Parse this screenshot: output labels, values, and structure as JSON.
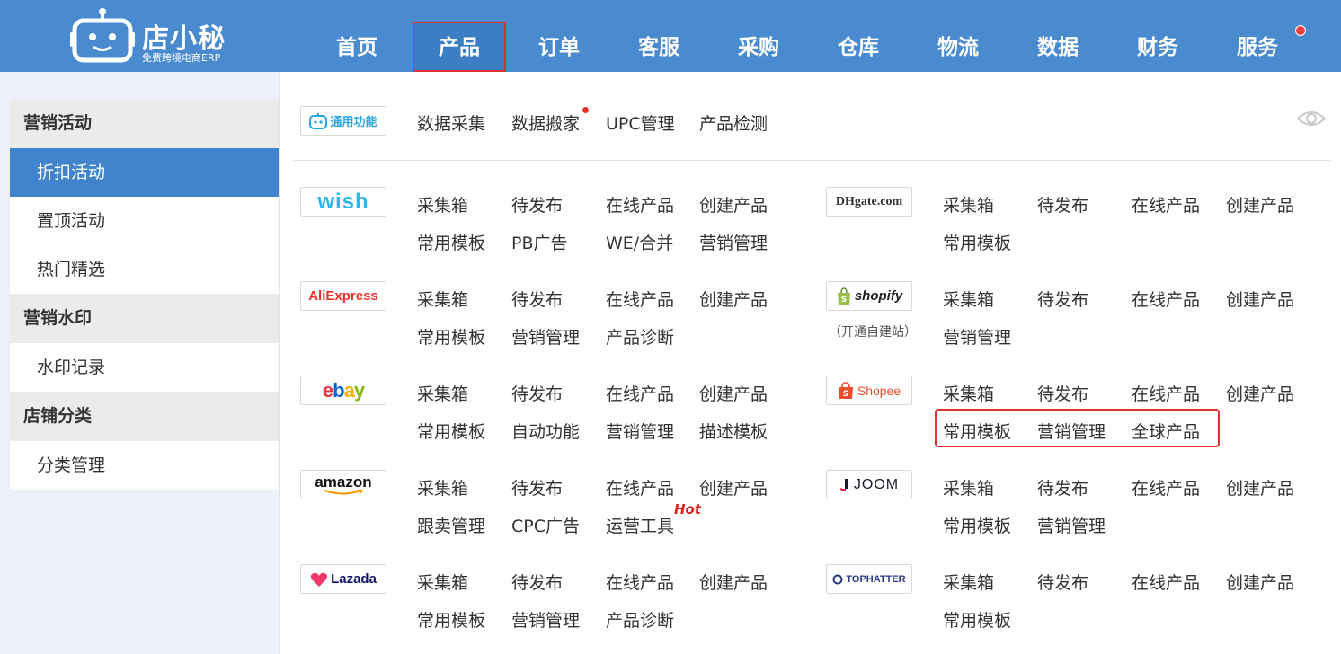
{
  "header": {
    "logo_title": "店小秘",
    "logo_subtitle": "免费跨境电商ERP",
    "nav": [
      {
        "label": "首页"
      },
      {
        "label": "产品",
        "active": true
      },
      {
        "label": "订单"
      },
      {
        "label": "客服"
      },
      {
        "label": "采购"
      },
      {
        "label": "仓库"
      },
      {
        "label": "物流"
      },
      {
        "label": "数据"
      },
      {
        "label": "财务"
      },
      {
        "label": "服务",
        "notification_dot": true
      }
    ]
  },
  "sidebar": {
    "groups": [
      {
        "title": "营销活动",
        "items": [
          "折扣活动",
          "置顶活动",
          "热门精选"
        ]
      },
      {
        "title": "营销水印",
        "items": [
          "水印记录"
        ]
      },
      {
        "title": "店铺分类",
        "items": [
          "分类管理"
        ]
      }
    ],
    "active_item": "折扣活动"
  },
  "dropdown": {
    "general": {
      "badge": "通用功能",
      "links": [
        "数据采集",
        "数据搬家",
        "UPC管理",
        "产品检测"
      ],
      "new_dot_on": "数据搬家",
      "visibility_icon": "eye-icon"
    },
    "platforms_left": [
      {
        "logo": "wish",
        "links": [
          "采集箱",
          "待发布",
          "在线产品",
          "创建产品",
          "常用模板",
          "PB广告",
          "WE/合并",
          "营销管理"
        ]
      },
      {
        "logo": "AliExpress",
        "links": [
          "采集箱",
          "待发布",
          "在线产品",
          "创建产品",
          "常用模板",
          "营销管理",
          "产品诊断"
        ]
      },
      {
        "logo": "ebay",
        "links": [
          "采集箱",
          "待发布",
          "在线产品",
          "创建产品",
          "常用模板",
          "自动功能",
          "营销管理",
          "描述模板"
        ]
      },
      {
        "logo": "amazon",
        "links": [
          "采集箱",
          "待发布",
          "在线产品",
          "创建产品",
          "跟卖管理",
          "CPC广告",
          "运营工具"
        ],
        "hot_label": "Hot"
      },
      {
        "logo": "Lazada",
        "links": [
          "采集箱",
          "待发布",
          "在线产品",
          "创建产品",
          "常用模板",
          "营销管理",
          "产品诊断"
        ]
      }
    ],
    "platforms_right": [
      {
        "logo": "DHgate.com",
        "links": [
          "采集箱",
          "待发布",
          "在线产品",
          "创建产品",
          "常用模板"
        ]
      },
      {
        "logo": "shopify",
        "note": "（开通自建站）",
        "links": [
          "采集箱",
          "待发布",
          "在线产品",
          "创建产品",
          "营销管理"
        ]
      },
      {
        "logo": "Shopee",
        "links": [
          "采集箱",
          "待发布",
          "在线产品",
          "创建产品",
          "常用模板",
          "营销管理",
          "全球产品"
        ],
        "highlighted": [
          "常用模板",
          "营销管理",
          "全球产品"
        ]
      },
      {
        "logo": "JOOM",
        "links": [
          "采集箱",
          "待发布",
          "在线产品",
          "创建产品",
          "常用模板",
          "营销管理"
        ]
      },
      {
        "logo": "TOPHATTER",
        "links": [
          "采集箱",
          "待发布",
          "在线产品",
          "创建产品",
          "常用模板"
        ]
      }
    ]
  },
  "colors": {
    "header_bg": "#4a8bd0",
    "active_nav_border": "#e0302f",
    "sidebar_active": "#3f84cc",
    "page_bg": "#eef1f9"
  }
}
